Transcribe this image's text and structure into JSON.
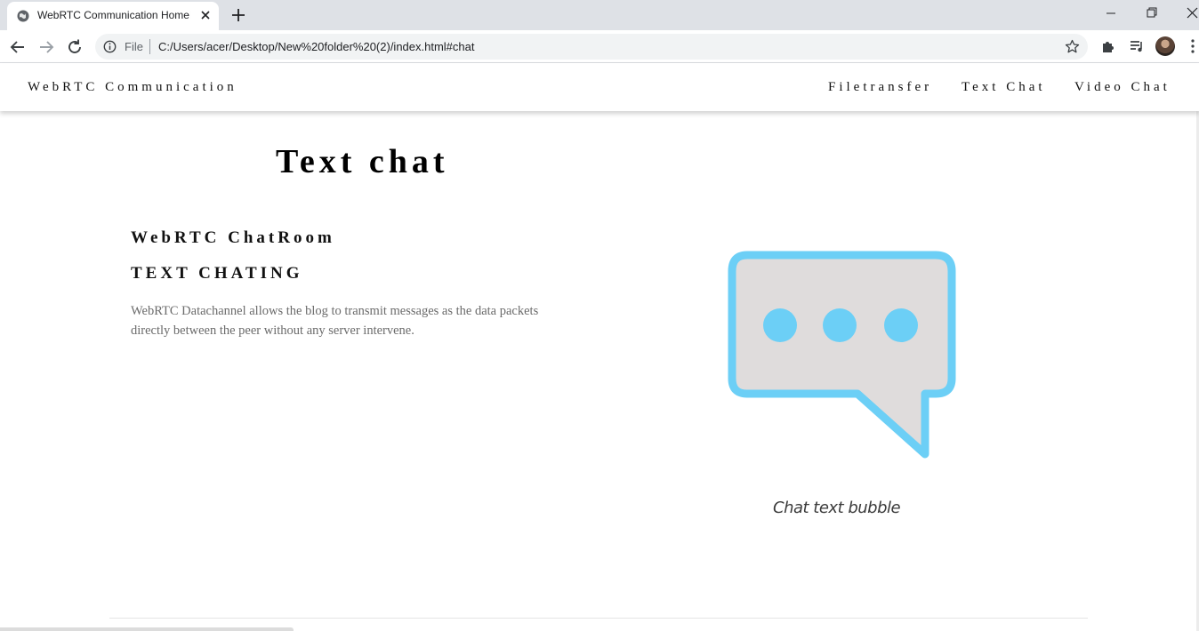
{
  "browser": {
    "tab_title": "WebRTC Communication HomePage",
    "omnibox": {
      "scheme_label": "File",
      "url": "C:/Users/acer/Desktop/New%20folder%20(2)/index.html#chat"
    }
  },
  "site_nav": {
    "brand": "WebRTC Communication",
    "links": [
      "Filetransfer",
      "Text Chat",
      "Video Chat"
    ]
  },
  "main": {
    "title": "Text chat",
    "subtitle": "WebRTC ChatRoom",
    "heading": "TEXT CHATING",
    "description": "WebRTC Datachannel allows the blog to transmit messages as the data packets directly between the peer without any server intervene."
  },
  "illustration": {
    "icon": "chat-bubble-icon",
    "caption": "Chat text bubble",
    "stroke_color": "#6ccff6",
    "fill_color": "#dfdcdc"
  }
}
